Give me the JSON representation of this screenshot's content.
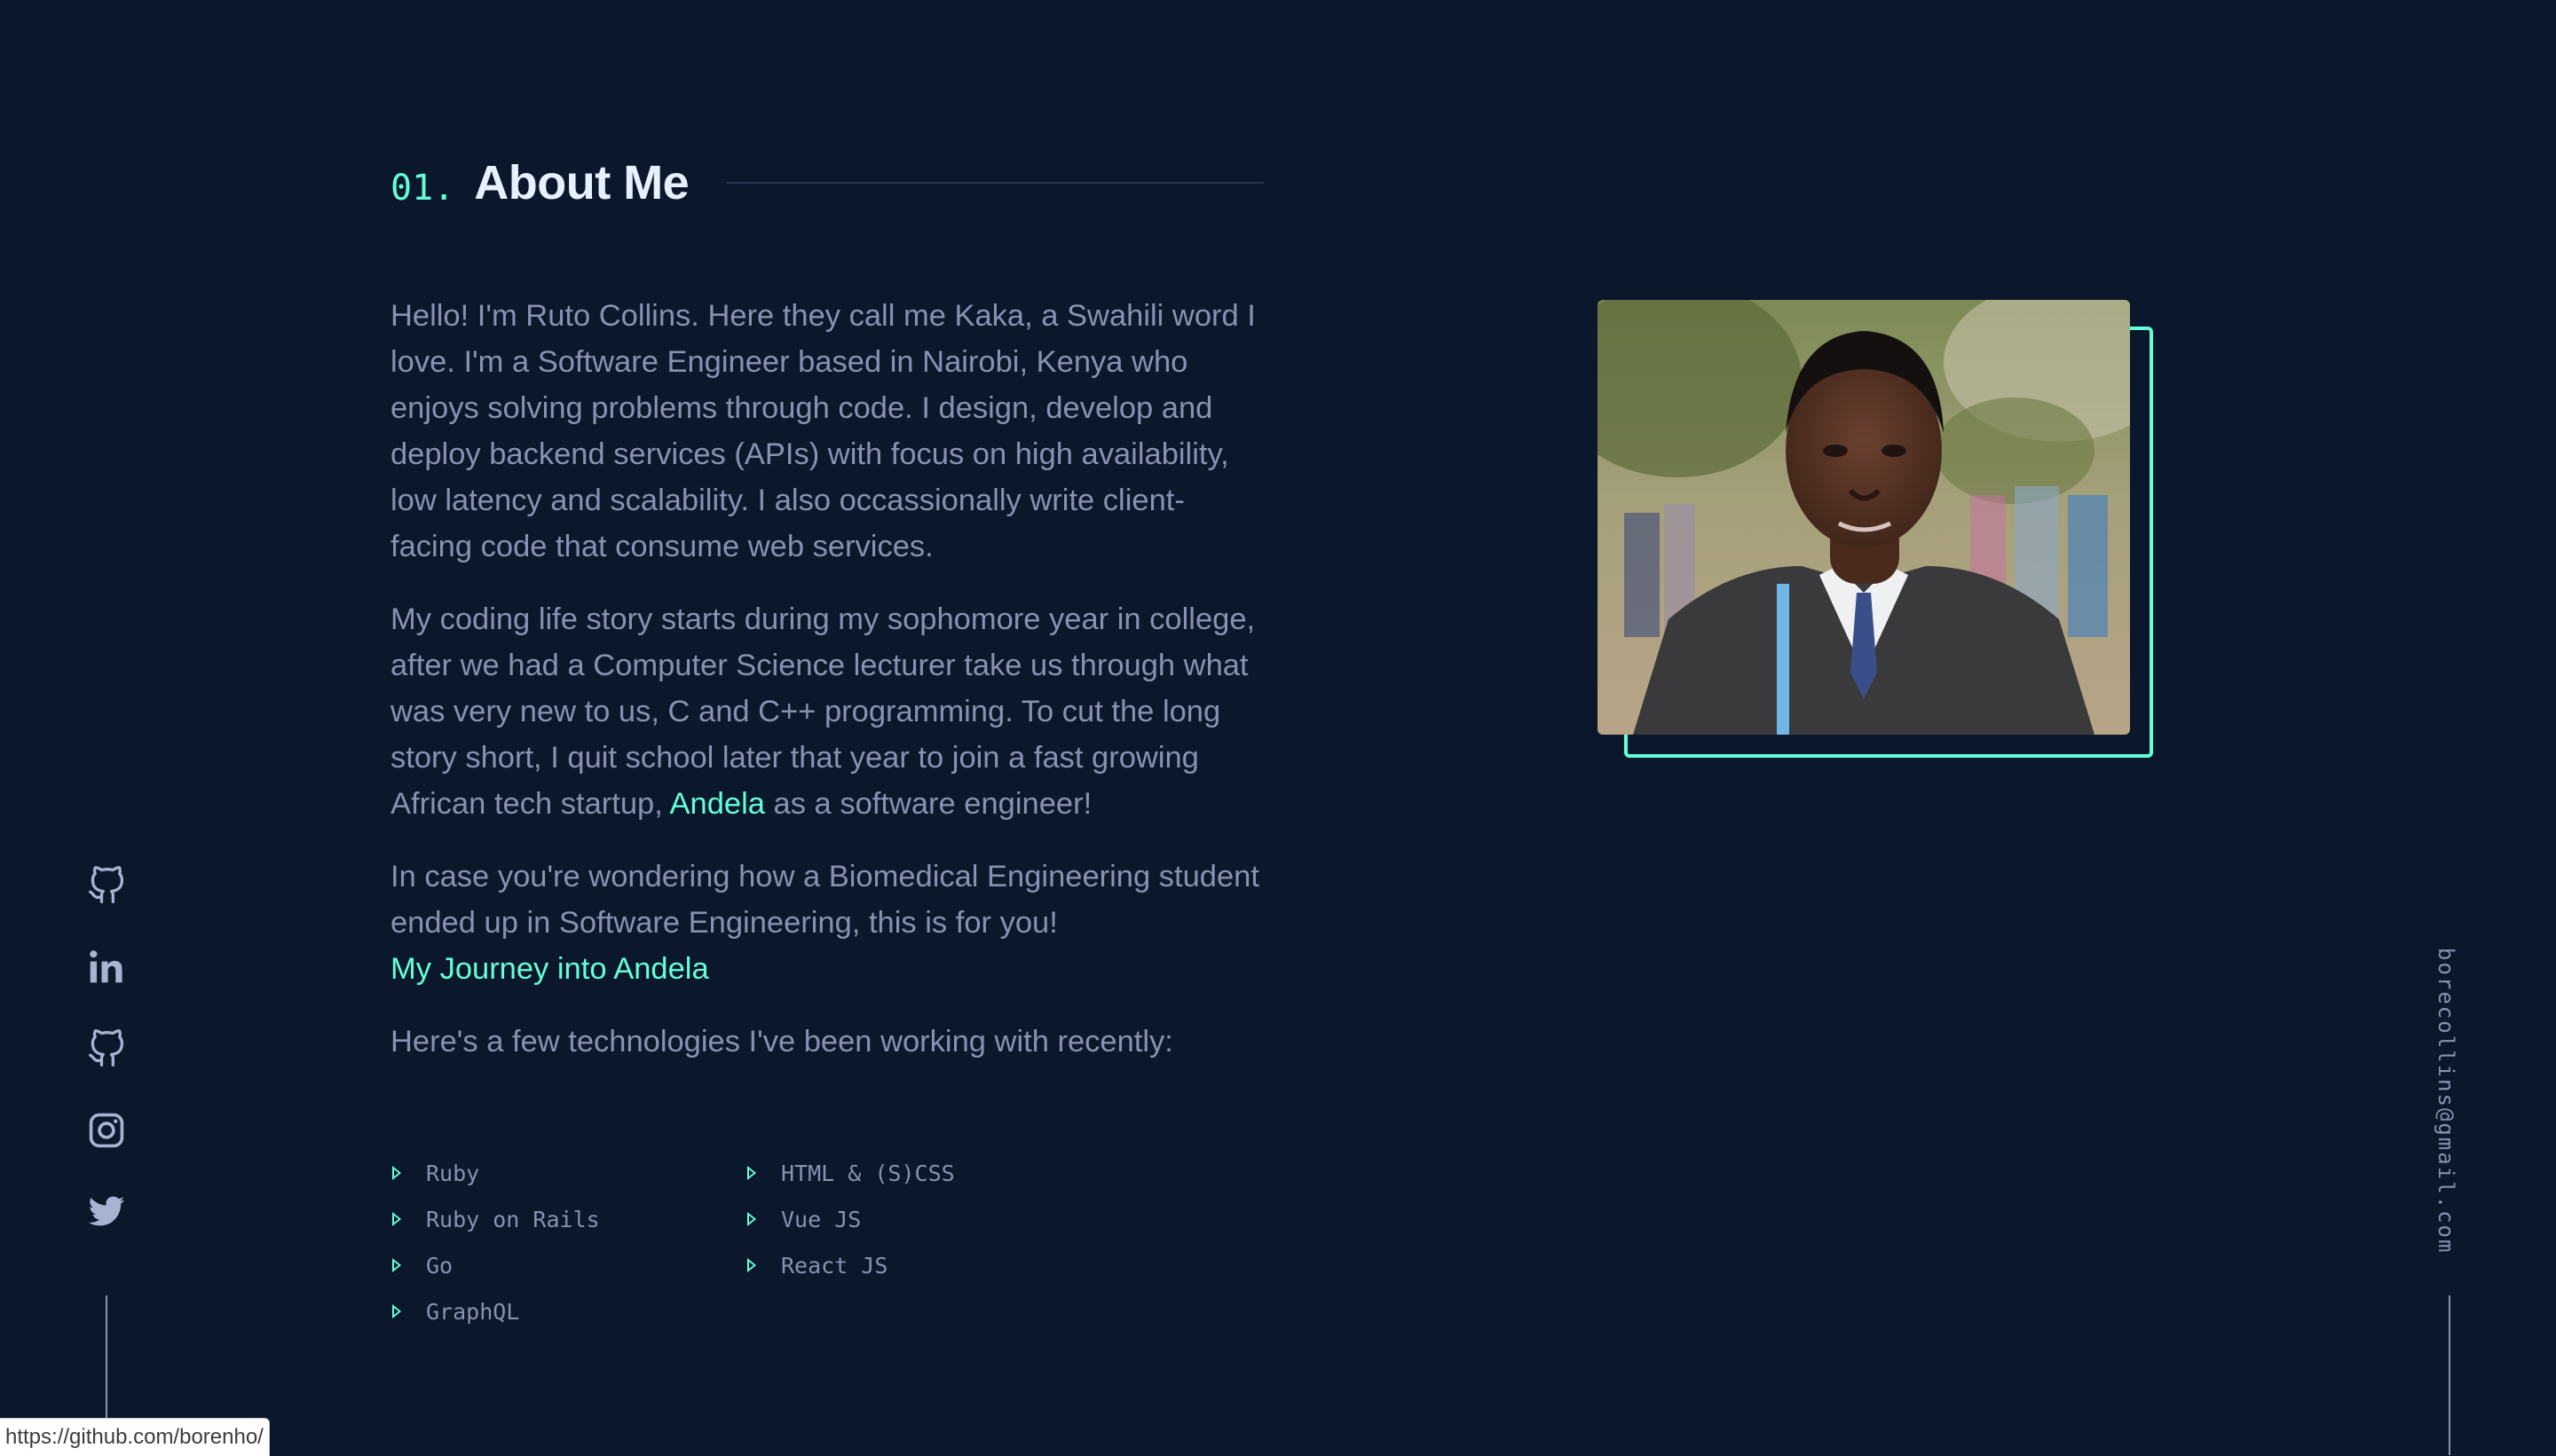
{
  "heading": {
    "number": "01.",
    "title": "About Me"
  },
  "about": {
    "p1": "Hello! I'm Ruto Collins. Here they call me Kaka, a Swahili word I love. I'm a Software Engineer based in Nairobi, Kenya who enjoys solving problems through code. I design, develop and deploy backend services (APIs) with focus on high availability, low latency and scalability. I also occassionally write client-facing code that consume web services.",
    "p2_before": "My coding life story starts during my sophomore year in college, after we had a Computer Science lecturer take us through what was very new to us, C and C++ programming. To cut the long story short, I quit school later that year to join a fast growing African tech startup, ",
    "p2_link": "Andela",
    "p2_after": " as a software engineer!",
    "p3": "In case you're wondering how a Biomedical Engineering student ended up in Software Engineering, this is for you!",
    "p3_link": "My Journey into Andela",
    "p4": "Here's a few technologies I've been working with recently:"
  },
  "technologies": [
    "Ruby",
    "Ruby on Rails",
    "Go",
    "GraphQL",
    "HTML & (S)CSS",
    "Vue JS",
    "React JS"
  ],
  "social": {
    "icons": [
      "github-icon",
      "linkedin-icon",
      "github-icon",
      "instagram-icon",
      "twitter-icon"
    ]
  },
  "email": "borecollins@gmail.com",
  "status_bar": {
    "url": "https://github.com/borenho/"
  },
  "colors": {
    "background": "#0b172a",
    "accent": "#64ffda",
    "text": "#8892b0",
    "heading": "#e6f1ff"
  }
}
